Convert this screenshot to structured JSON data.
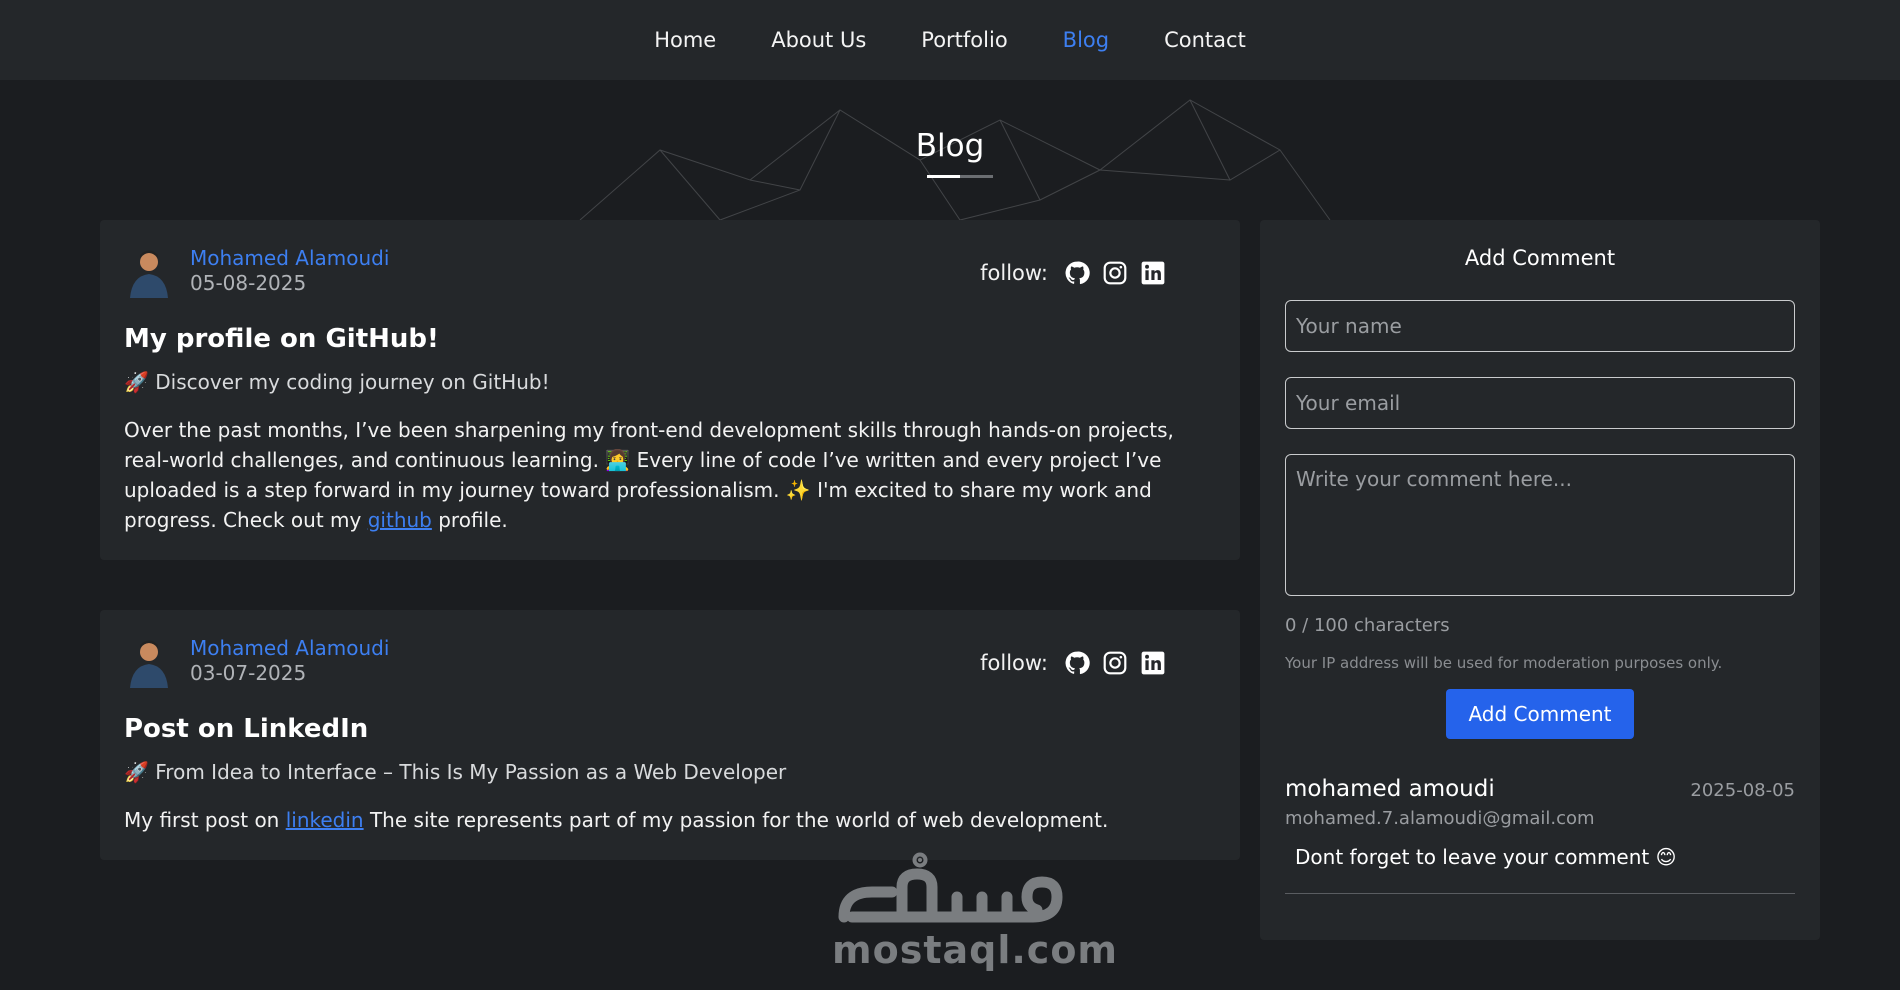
{
  "nav": {
    "items": [
      {
        "label": "Home",
        "active": false
      },
      {
        "label": "About Us",
        "active": false
      },
      {
        "label": "Portfolio",
        "active": false
      },
      {
        "label": "Blog",
        "active": true
      },
      {
        "label": "Contact",
        "active": false
      }
    ]
  },
  "page": {
    "title": "Blog"
  },
  "posts": [
    {
      "author": "Mohamed Alamoudi",
      "date": "05-08-2025",
      "follow_label": "follow:",
      "title": "My profile on GitHub!",
      "subtitle": "🚀 Discover my coding journey on GitHub!",
      "body_before_link": "Over the past months, I’ve been sharpening my front-end development skills through hands-on projects, real-world challenges, and continuous learning. 👩‍💻 Every line of code I’ve written and every project I’ve uploaded is a step forward in my journey toward professionalism. ✨ I'm excited to share my work and progress. Check out my ",
      "link_text": "github",
      "body_after_link": " profile."
    },
    {
      "author": "Mohamed Alamoudi",
      "date": "03-07-2025",
      "follow_label": "follow:",
      "title": "Post on LinkedIn",
      "subtitle": "🚀 From Idea to Interface – This Is My Passion as a Web Developer",
      "body_before_link": "My first post on ",
      "link_text": "linkedin",
      "body_after_link": " The site represents part of my passion for the world of web development."
    }
  ],
  "follow_icons": [
    "github-icon",
    "instagram-icon",
    "linkedin-icon"
  ],
  "comment_form": {
    "title": "Add Comment",
    "name_placeholder": "Your name",
    "email_placeholder": "Your email",
    "comment_placeholder": "Write your comment here...",
    "char_count": "0 / 100 characters",
    "note": "Your IP address will be used for moderation purposes only.",
    "submit_label": "Add Comment"
  },
  "comments": [
    {
      "name": "mohamed amoudi",
      "date": "2025-08-05",
      "email": "mohamed.7.alamoudi@gmail.com",
      "text": "Dont forget to leave your comment 😊"
    }
  ],
  "watermark": {
    "arabic": "مستقل",
    "latin": "mostaql.com"
  },
  "colors": {
    "background": "#1b1d20",
    "card": "#24272a",
    "accent": "#3d7ff1",
    "button": "#2563eb"
  }
}
